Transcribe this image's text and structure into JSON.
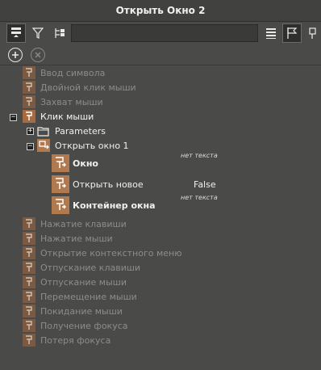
{
  "window": {
    "title": "Открыть Окно 2"
  },
  "search": {
    "value": "",
    "placeholder": ""
  },
  "tree": {
    "events_before": [
      "Ввод символа",
      "Двойной клик мыши",
      "Захват мыши"
    ],
    "active_event": "Клик мыши",
    "parameters_label": "Parameters",
    "action_label": "Открыть окно 1",
    "properties": [
      {
        "name": "Окно",
        "value": "нет текста"
      },
      {
        "name": "Открыть новое",
        "value": "False"
      },
      {
        "name": "Контейнер окна",
        "value": "нет текста"
      }
    ],
    "events_after": [
      "Нажатие клавиши",
      "Нажатие мыши",
      "Открытие контекстного меню",
      "Отпускание клавиши",
      "Отпускание мыши",
      "Перемещение мыши",
      "Покидание мыши",
      "Получение фокуса",
      "Потеря фокуса"
    ]
  },
  "colors": {
    "background": "#4a4a48",
    "event_icon": "#a66b40",
    "property_icon": "#b07a4e"
  }
}
